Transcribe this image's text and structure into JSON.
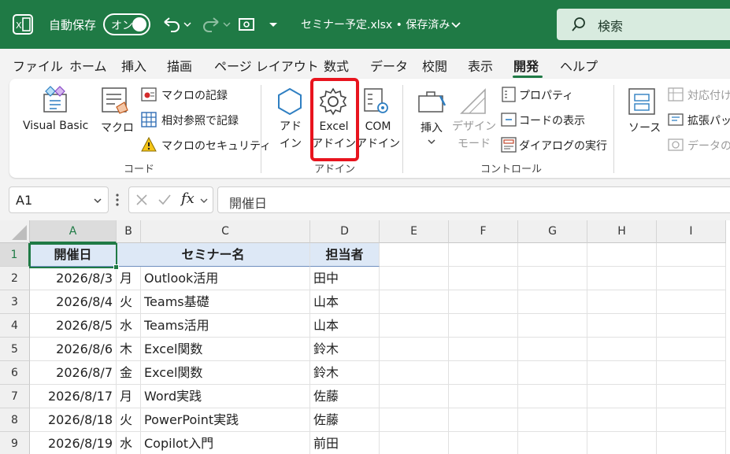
{
  "titlebar": {
    "autosave_label": "自動保存",
    "autosave_state": "オン",
    "filename": "セミナー予定.xlsx • 保存済み",
    "search_label": "検索"
  },
  "tabs": [
    "ファイル",
    "ホーム",
    "挿入",
    "描画",
    "ページ レイアウト",
    "数式",
    "データ",
    "校閲",
    "表示",
    "開発",
    "ヘルプ"
  ],
  "active_tab": "開発",
  "ribbon": {
    "code": {
      "label": "コード",
      "visual_basic": "Visual Basic",
      "macro": "マクロ",
      "record_macro": "マクロの記録",
      "relative_ref": "相対参照で記録",
      "macro_security": "マクロのセキュリティ"
    },
    "addins": {
      "label": "アドイン",
      "addin_line1": "アド",
      "addin_line2": "イン",
      "excel_addin_line1": "Excel",
      "excel_addin_line2": "アドイン",
      "com_addin_line1": "COM",
      "com_addin_line2": "アドイン"
    },
    "controls": {
      "label": "コントロール",
      "insert": "挿入",
      "design_mode_line1": "デザイン",
      "design_mode_line2": "モード",
      "properties": "プロパティ",
      "view_code": "コードの表示",
      "run_dialog": "ダイアログの実行"
    },
    "xml": {
      "source": "ソース",
      "map_properties": "対応付け",
      "expansion_packs": "拡張パッ",
      "refresh_data": "データの更"
    }
  },
  "formula_bar": {
    "name_box": "A1",
    "fx": "fx",
    "content": "開催日"
  },
  "columns": [
    "A",
    "B",
    "C",
    "D",
    "E",
    "F",
    "G",
    "H",
    "I"
  ],
  "rows": [
    "1",
    "2",
    "3",
    "4",
    "5",
    "6",
    "7",
    "8",
    "9"
  ],
  "table": {
    "headers": [
      "開催日",
      "セミナー名",
      "担当者"
    ],
    "rows": [
      [
        "2026/8/3",
        "月",
        "Outlook活用",
        "田中"
      ],
      [
        "2026/8/4",
        "火",
        "Teams基礎",
        "山本"
      ],
      [
        "2026/8/5",
        "水",
        "Teams活用",
        "山本"
      ],
      [
        "2026/8/6",
        "木",
        "Excel関数",
        "鈴木"
      ],
      [
        "2026/8/7",
        "金",
        "Excel関数",
        "鈴木"
      ],
      [
        "2026/8/17",
        "月",
        "Word実践",
        "佐藤"
      ],
      [
        "2026/8/18",
        "火",
        "PowerPoint実践",
        "佐藤"
      ],
      [
        "2026/8/19",
        "水",
        "Copilot入門",
        "前田"
      ]
    ]
  },
  "colors": {
    "brand": "#1f7a45",
    "highlight": "#e8141e",
    "header_fill": "#dde8f6"
  }
}
